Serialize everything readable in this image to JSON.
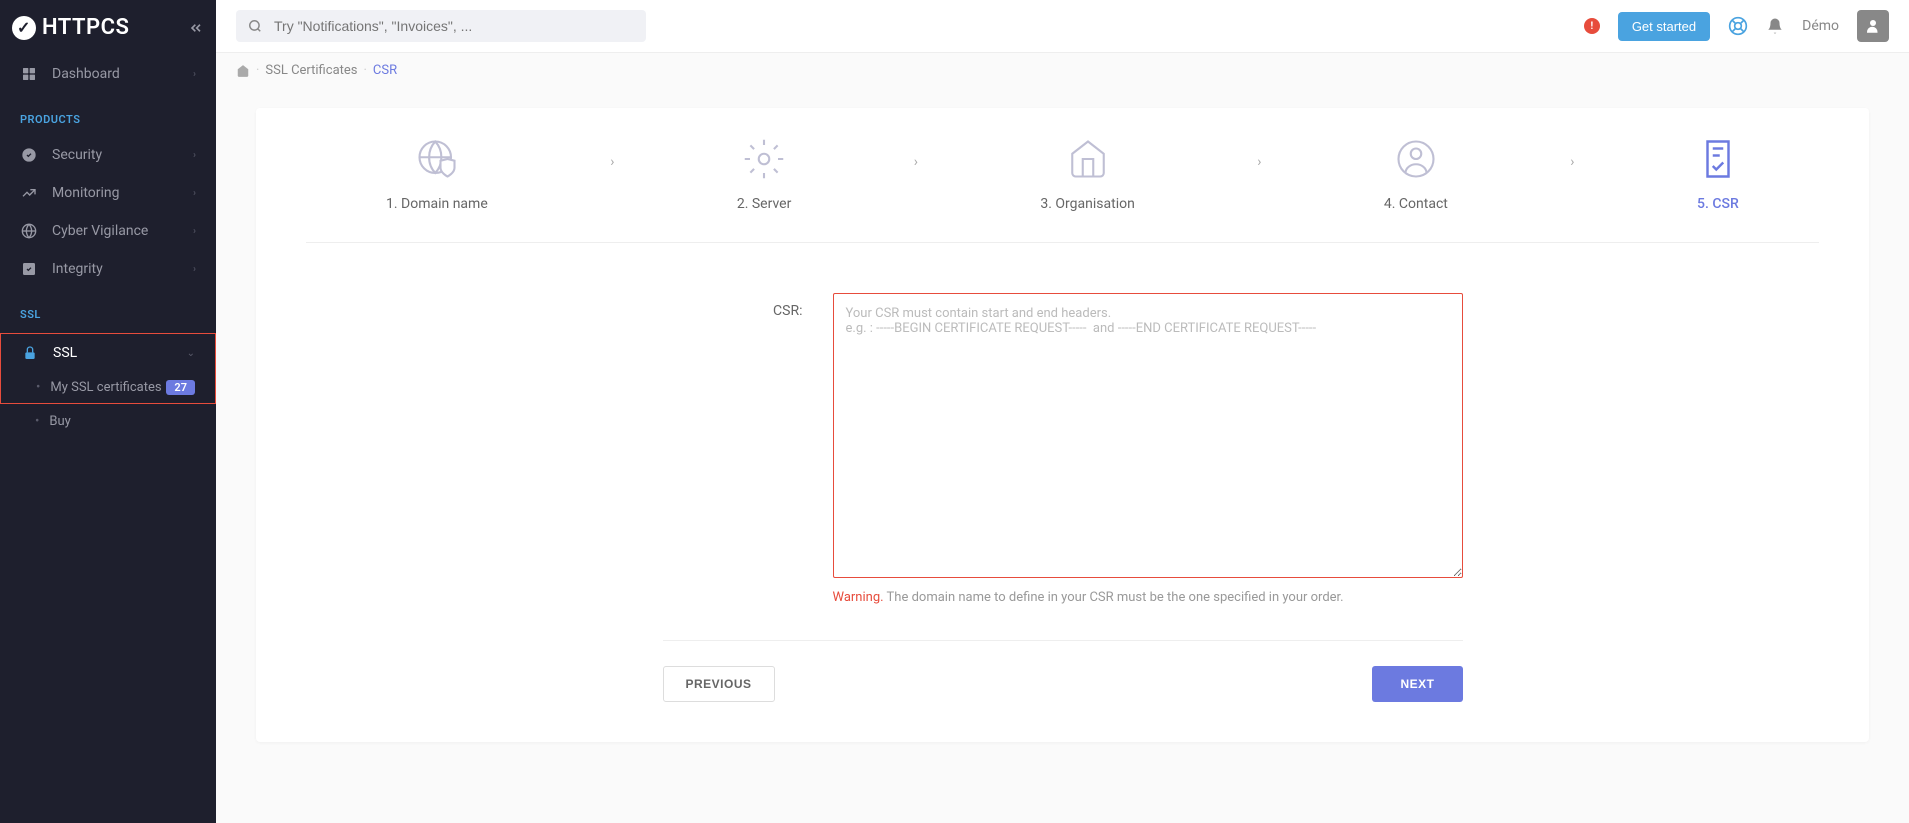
{
  "brand": "HTTPCS",
  "search": {
    "placeholder": "Try \"Notifications\", \"Invoices\", ..."
  },
  "topbar": {
    "getStarted": "Get started",
    "userName": "Démo"
  },
  "sidebar": {
    "dashboard": "Dashboard",
    "productsHeading": "PRODUCTS",
    "security": "Security",
    "monitoring": "Monitoring",
    "cyberVigilance": "Cyber Vigilance",
    "integrity": "Integrity",
    "sslHeading": "SSL",
    "ssl": "SSL",
    "mySslCerts": "My SSL certificates",
    "mySslCertsBadge": "27",
    "buy": "Buy"
  },
  "breadcrumb": {
    "sslCertificates": "SSL Certificates",
    "csr": "CSR"
  },
  "stepper": {
    "step1": "1. Domain name",
    "step2": "2. Server",
    "step3": "3. Organisation",
    "step4": "4. Contact",
    "step5": "5. CSR"
  },
  "form": {
    "csrLabel": "CSR:",
    "csrPlaceholder": "Your CSR must contain start and end headers.\ne.g. : -----BEGIN CERTIFICATE REQUEST-----  and -----END CERTIFICATE REQUEST-----",
    "warningLabel": "Warning.",
    "warningText": " The domain name to define in your CSR must be the one specified in your order.",
    "previous": "PREVIOUS",
    "next": "NEXT"
  }
}
